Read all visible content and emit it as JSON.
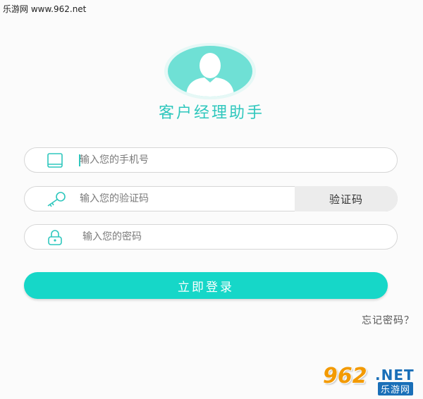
{
  "watermark_top": "乐游网 www.962.net",
  "app": {
    "title": "客户经理助手"
  },
  "form": {
    "phone": {
      "placeholder": "输入您的手机号",
      "icon": "tablet-icon"
    },
    "code": {
      "placeholder": "输入您的验证码",
      "icon": "key-icon",
      "button_label": "验证码"
    },
    "password": {
      "placeholder": "输入您的密码",
      "icon": "lock-icon"
    },
    "login_label": "立即登录",
    "forgot_label": "忘记密码？"
  },
  "colors": {
    "accent": "#16d7c8",
    "title": "#2ec7bd",
    "avatar": "#6fe0d5"
  },
  "logo": {
    "number": "962",
    "suffix": ".NET",
    "text": "乐游网"
  }
}
